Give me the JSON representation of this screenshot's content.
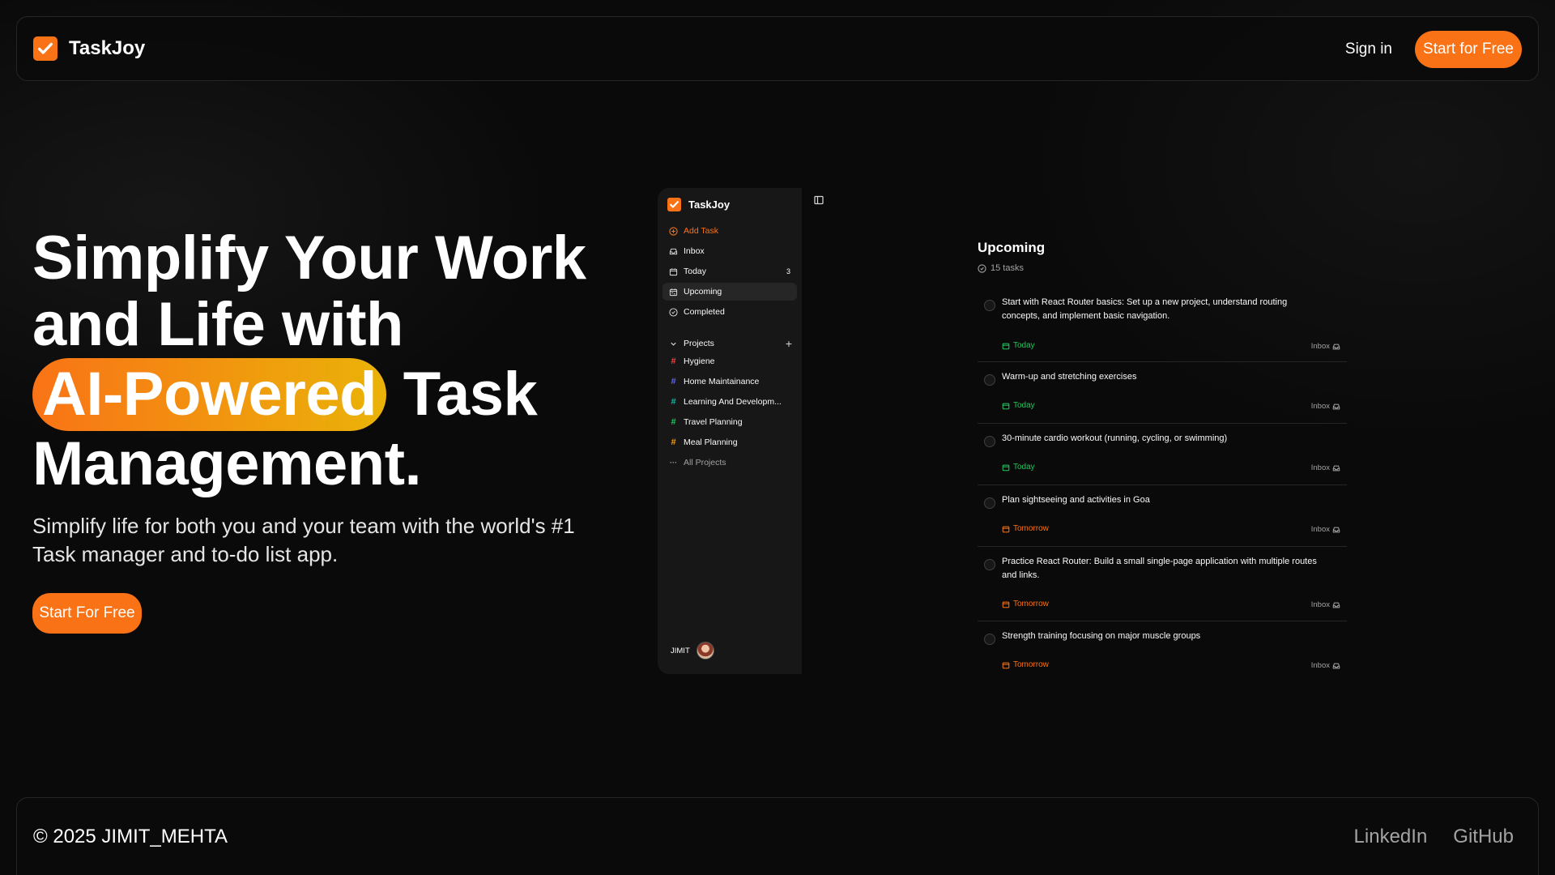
{
  "brand": {
    "name": "TaskJoy",
    "accent": "#f97316"
  },
  "header": {
    "signin_label": "Sign in",
    "cta_label": "Start for Free"
  },
  "hero": {
    "title_line1": "Simplify Your Work",
    "title_line2": "and Life with",
    "title_highlight": "AI-Powered",
    "title_after_highlight": "Task",
    "title_line4": "Management.",
    "subtitle": "Simplify life for both you and your team with the world's #1 Task manager and to-do list app.",
    "cta_label": "Start For Free"
  },
  "preview": {
    "sidebar": {
      "brand": "TaskJoy",
      "add_task": "Add Task",
      "items": [
        {
          "label": "Inbox",
          "icon": "inbox-icon"
        },
        {
          "label": "Today",
          "icon": "calendar-icon",
          "count": "3"
        },
        {
          "label": "Upcoming",
          "icon": "calendar-range-icon"
        },
        {
          "label": "Completed",
          "icon": "check-circle-icon"
        }
      ],
      "projects_label": "Projects",
      "projects": [
        {
          "label": "Hygiene",
          "color": "#ef4444"
        },
        {
          "label": "Home Maintainance",
          "color": "#6366f1"
        },
        {
          "label": "Learning And Developm...",
          "color": "#14b8a6"
        },
        {
          "label": "Travel Planning",
          "color": "#22c55e"
        },
        {
          "label": "Meal Planning",
          "color": "#f59e0b"
        }
      ],
      "all_projects": "All Projects",
      "user": "JIMIT"
    },
    "upcoming": {
      "title": "Upcoming",
      "count": "15 tasks",
      "tasks": [
        {
          "text": "Start with React Router basics: Set up a new project, understand routing concepts, and implement basic navigation.",
          "date": "Today",
          "inbox": "Inbox"
        },
        {
          "text": "Warm-up and stretching exercises",
          "date": "Today",
          "inbox": "Inbox"
        },
        {
          "text": "30-minute cardio workout (running, cycling, or swimming)",
          "date": "Today",
          "inbox": "Inbox"
        },
        {
          "text": "Plan sightseeing and activities in Goa",
          "date": "Tomorrow",
          "inbox": "Inbox"
        },
        {
          "text": "Practice React Router: Build a small single-page application with multiple routes and links.",
          "date": "Tomorrow",
          "inbox": "Inbox"
        },
        {
          "text": "Strength training focusing on major muscle groups",
          "date": "Tomorrow",
          "inbox": "Inbox"
        }
      ]
    }
  },
  "footer": {
    "copyright": "© 2025 JIMIT_MEHTA",
    "links": [
      "LinkedIn",
      "GitHub"
    ]
  }
}
